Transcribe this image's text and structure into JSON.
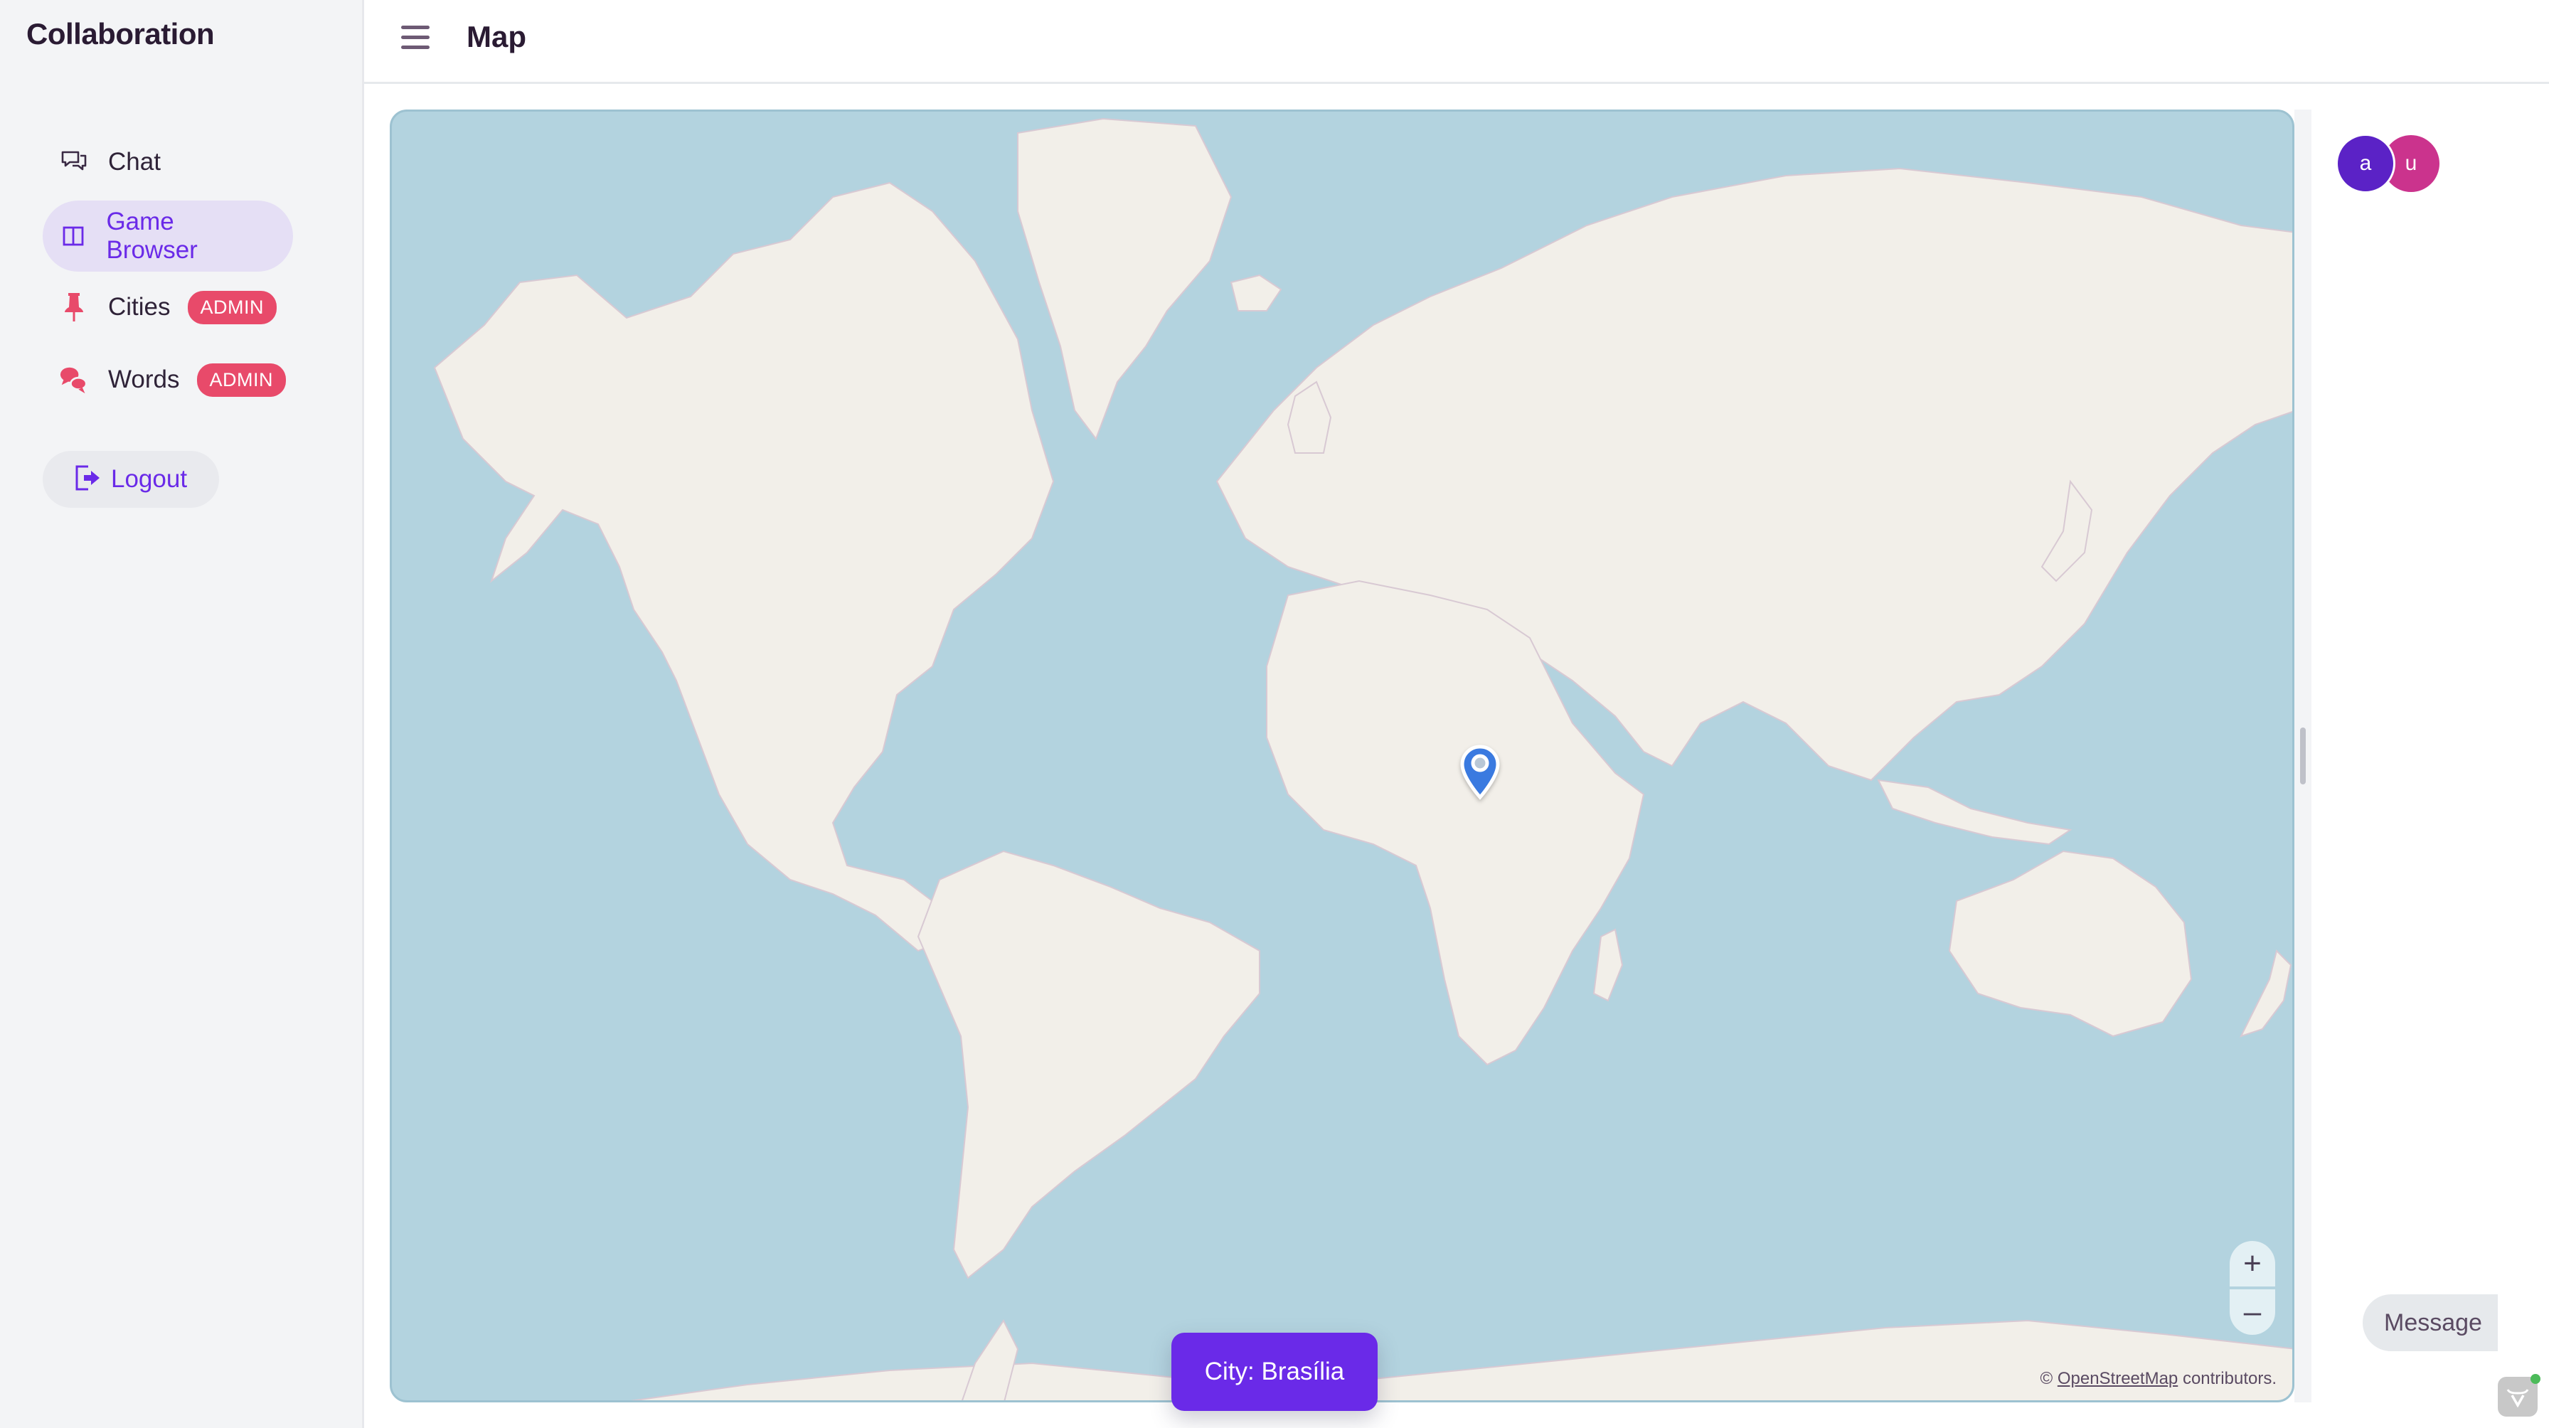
{
  "app": {
    "title": "Collaboration"
  },
  "sidebar": {
    "items": [
      {
        "label": "Chat",
        "icon": "chat-bubbles-outline-icon",
        "active": false
      },
      {
        "label": "Game Browser",
        "icon": "columns-icon",
        "active": true
      },
      {
        "label": "Cities",
        "icon": "pushpin-icon",
        "badge": "ADMIN"
      },
      {
        "label": "Words",
        "icon": "speech-bubbles-icon",
        "badge": "ADMIN"
      }
    ],
    "logout_label": "Logout"
  },
  "header": {
    "title": "Map",
    "menu_icon": "hamburger-icon"
  },
  "map": {
    "zoom_in": "+",
    "zoom_out": "–",
    "attribution_prefix": "©",
    "attribution_link": "OpenStreetMap",
    "attribution_suffix": "contributors.",
    "marker": {
      "label": "Brasília",
      "icon": "map-pin-icon",
      "color": "#3a7ae0"
    },
    "ocean_color": "#b3d3df",
    "land_color": "#f2efe9"
  },
  "city_banner": {
    "text": "City: Brasília",
    "color": "#6a2ae8"
  },
  "users": {
    "avatars": [
      {
        "initial": "a",
        "color": "#5b22c6"
      },
      {
        "initial": "u",
        "color": "#cb338d"
      }
    ]
  },
  "message_button": {
    "label": "Message"
  },
  "colors": {
    "accent": "#6a2ae8",
    "admin_badge": "#e84a6a",
    "active_bg": "#e5dff5"
  }
}
